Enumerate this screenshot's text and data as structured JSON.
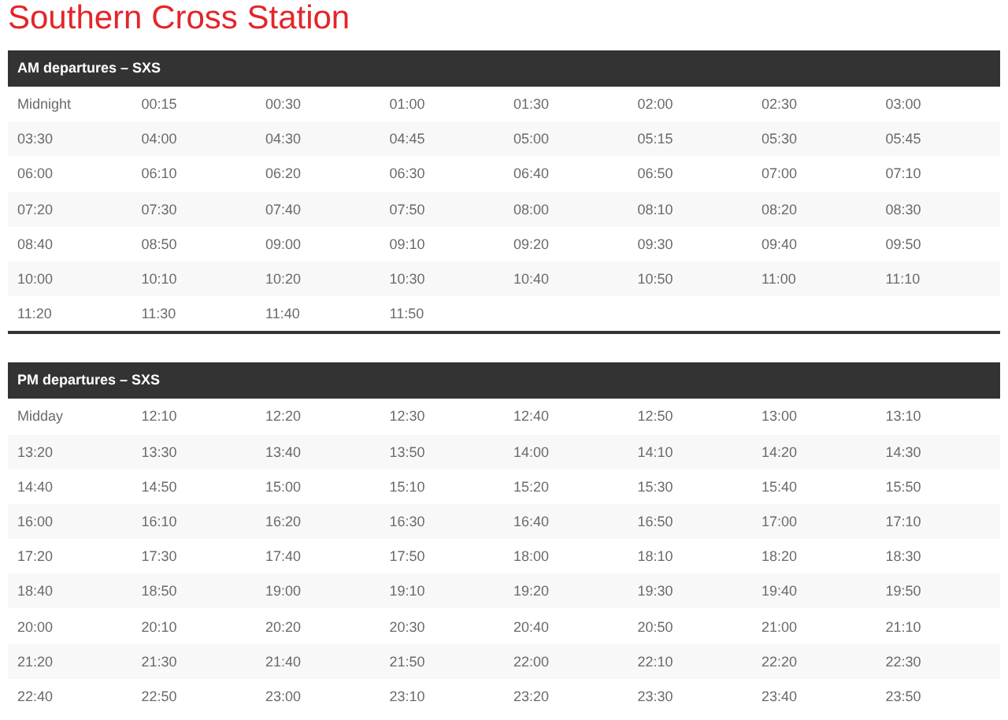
{
  "title": "Southern Cross Station",
  "tables": [
    {
      "heading": "AM departures – SXS",
      "rows": [
        [
          "Midnight",
          "00:15",
          "00:30",
          "01:00",
          "01:30",
          "02:00",
          "02:30",
          "03:00"
        ],
        [
          "03:30",
          "04:00",
          "04:30",
          "04:45",
          "05:00",
          "05:15",
          "05:30",
          "05:45"
        ],
        [
          "06:00",
          "06:10",
          "06:20",
          "06:30",
          "06:40",
          "06:50",
          "07:00",
          "07:10"
        ],
        [
          "07:20",
          "07:30",
          "07:40",
          "07:50",
          "08:00",
          "08:10",
          "08:20",
          "08:30"
        ],
        [
          "08:40",
          "08:50",
          "09:00",
          "09:10",
          "09:20",
          "09:30",
          "09:40",
          "09:50"
        ],
        [
          "10:00",
          "10:10",
          "10:20",
          "10:30",
          "10:40",
          "10:50",
          "11:00",
          "11:10"
        ],
        [
          "11:20",
          "11:30",
          "11:40",
          "11:50"
        ]
      ]
    },
    {
      "heading": "PM departures – SXS",
      "rows": [
        [
          "Midday",
          "12:10",
          "12:20",
          "12:30",
          "12:40",
          "12:50",
          "13:00",
          "13:10"
        ],
        [
          "13:20",
          "13:30",
          "13:40",
          "13:50",
          "14:00",
          "14:10",
          "14:20",
          "14:30"
        ],
        [
          "14:40",
          "14:50",
          "15:00",
          "15:10",
          "15:20",
          "15:30",
          "15:40",
          "15:50"
        ],
        [
          "16:00",
          "16:10",
          "16:20",
          "16:30",
          "16:40",
          "16:50",
          "17:00",
          "17:10"
        ],
        [
          "17:20",
          "17:30",
          "17:40",
          "17:50",
          "18:00",
          "18:10",
          "18:20",
          "18:30"
        ],
        [
          "18:40",
          "18:50",
          "19:00",
          "19:10",
          "19:20",
          "19:30",
          "19:40",
          "19:50"
        ],
        [
          "20:00",
          "20:10",
          "20:20",
          "20:30",
          "20:40",
          "20:50",
          "21:00",
          "21:10"
        ],
        [
          "21:20",
          "21:30",
          "21:40",
          "21:50",
          "22:00",
          "22:10",
          "22:20",
          "22:30"
        ],
        [
          "22:40",
          "22:50",
          "23:00",
          "23:10",
          "23:20",
          "23:30",
          "23:40",
          "23:50"
        ]
      ]
    }
  ]
}
